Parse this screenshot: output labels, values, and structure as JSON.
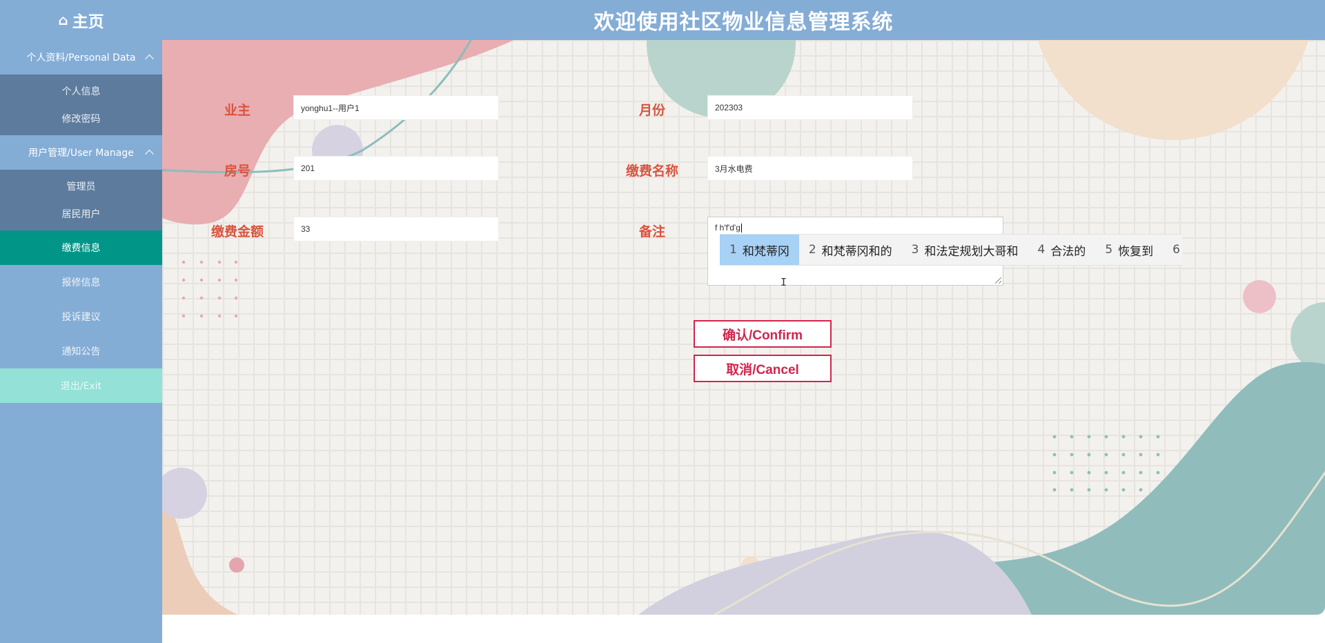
{
  "header": {
    "home_icon": "home-icon",
    "home_label": "主页",
    "title": "欢迎使用社区物业信息管理系统"
  },
  "sidebar": {
    "groups": [
      {
        "label": "个人资料/Personal Data",
        "items": [
          "个人信息",
          "修改密码"
        ]
      },
      {
        "label": "用户管理/User Manage",
        "items": [
          "管理员",
          "居民用户"
        ]
      }
    ],
    "items": [
      "缴费信息",
      "报修信息",
      "投诉建议",
      "通知公告",
      "退出/Exit"
    ],
    "active_item": "缴费信息"
  },
  "form": {
    "owner": {
      "label": "业主",
      "value": "yonghu1--用户1"
    },
    "month": {
      "label": "月份",
      "value": "202303"
    },
    "room": {
      "label": "房号",
      "value": "201"
    },
    "fee_name": {
      "label": "缴费名称",
      "value": "3月水电费"
    },
    "amount": {
      "label": "缴费金额",
      "value": "33"
    },
    "remark": {
      "label": "备注",
      "value": "f h'f'd'g"
    },
    "confirm_label": "确认/Confirm",
    "cancel_label": "取消/Cancel"
  },
  "ime": {
    "candidates": [
      {
        "num": "1",
        "text": "和梵蒂冈"
      },
      {
        "num": "2",
        "text": "和梵蒂冈和的"
      },
      {
        "num": "3",
        "text": "和法定规划大哥和"
      },
      {
        "num": "4",
        "text": "合法的"
      },
      {
        "num": "5",
        "text": "恢复到"
      },
      {
        "num": "6",
        "text": ""
      }
    ],
    "selected": "1"
  },
  "colors": {
    "header_bg": "#84add6",
    "submenu_bg": "#5d7c9d",
    "active_bg": "#009587",
    "exit_bg": "#93e1d7",
    "label_color": "#d9533e",
    "button_color": "#d2244b"
  }
}
